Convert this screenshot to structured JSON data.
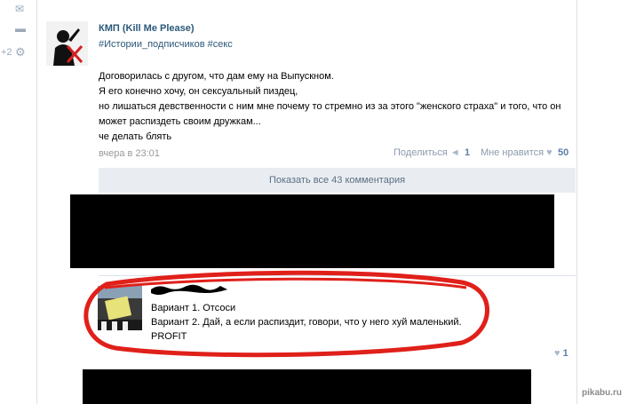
{
  "rail": {
    "comment_count": "+2"
  },
  "post": {
    "author": "КМП (Kill Me Please)",
    "tags": "#Истории_подписчиков #секс",
    "body": [
      "Договорилась с другом, что дам ему на Выпускном.",
      "Я его конечно хочу, он сексуальный пиздец,",
      "но лишаться девственности с ним мне почему то стремно из за этого \"женского страха\" и того, что он",
      "может распиздеть своим дружкам...",
      "че делать блять"
    ],
    "time": "вчера в 23:01",
    "share_label": "Поделиться",
    "share_count": "1",
    "like_label": "Мне нравится",
    "like_count": "50",
    "show_comments": "Показать все 43 комментария"
  },
  "comment": {
    "lines": [
      "Вариант 1. Отсоси",
      "Вариант 2. Дай, а если распиздит, говори, что у него хуй маленький.",
      "PROFIT"
    ],
    "like_count": "1"
  },
  "watermark": "pikabu.ru",
  "colors": {
    "link": "#2b587a",
    "highlight_ring": "#e0201a",
    "bar_bg": "#e9edf1"
  }
}
